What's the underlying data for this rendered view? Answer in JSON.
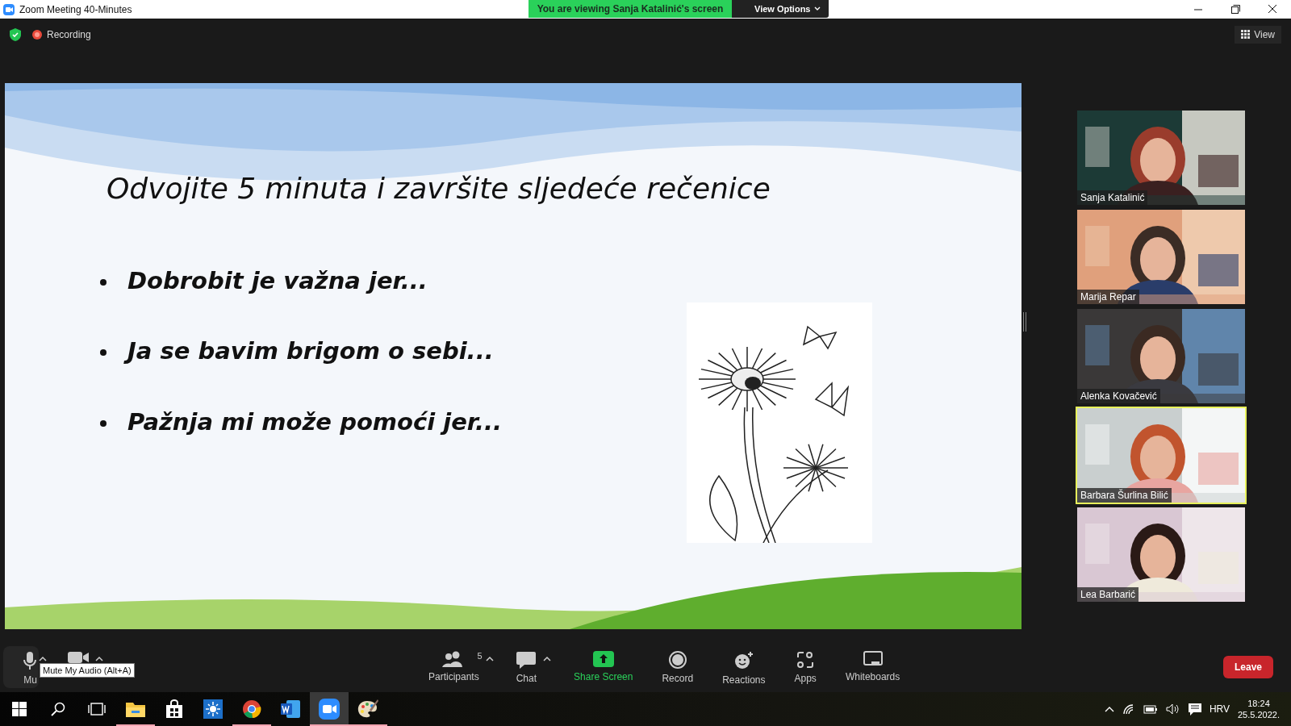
{
  "window": {
    "title": "Zoom Meeting 40-Minutes"
  },
  "banner": {
    "text": "You are viewing Sanja Katalinić's screen",
    "button": "View Options"
  },
  "meeting_bar": {
    "recording": "Recording",
    "view": "View"
  },
  "slide": {
    "title": "Odvojite 5 minuta i završite sljedeće rečenice",
    "bullets": [
      "Dobrobit je važna jer...",
      "Ja se bavim brigom o sebi...",
      "Pažnja mi može pomoći jer..."
    ]
  },
  "participants": [
    {
      "name": "Sanja Katalinić",
      "selected": false
    },
    {
      "name": "Marija Repar",
      "selected": false
    },
    {
      "name": "Alenka Kovačević",
      "selected": false
    },
    {
      "name": "Barbara Šurlina Bilić",
      "selected": true
    },
    {
      "name": "Lea Barbarić",
      "selected": false
    }
  ],
  "toolbar": {
    "left": [
      {
        "kind": "mic",
        "label": "Mu",
        "caret": true
      },
      {
        "kind": "video",
        "caret": true
      }
    ],
    "center": [
      {
        "kind": "participants",
        "label": "Participants",
        "count": "5",
        "caret": true
      },
      {
        "kind": "chat",
        "label": "Chat",
        "caret": true
      },
      {
        "kind": "share",
        "label": "Share Screen",
        "caret": false
      },
      {
        "kind": "record",
        "label": "Record",
        "caret": false
      },
      {
        "kind": "reactions",
        "label": "Reactions",
        "caret": false
      },
      {
        "kind": "apps",
        "label": "Apps",
        "caret": false
      },
      {
        "kind": "whiteboards",
        "label": "Whiteboards",
        "caret": false
      }
    ],
    "leave": "Leave",
    "tooltip": "Mute My Audio (Alt+A)"
  },
  "taskbar": {
    "apps": [
      {
        "kind": "explorer",
        "selected": false
      },
      {
        "kind": "store",
        "selected": false
      },
      {
        "kind": "weather",
        "selected": false
      },
      {
        "kind": "chrome",
        "selected": false
      },
      {
        "kind": "word",
        "selected": false
      },
      {
        "kind": "zoom",
        "selected": true
      },
      {
        "kind": "paint",
        "selected": false
      }
    ],
    "language": "HRV",
    "time": "18:24",
    "date": "25.5.2022."
  }
}
